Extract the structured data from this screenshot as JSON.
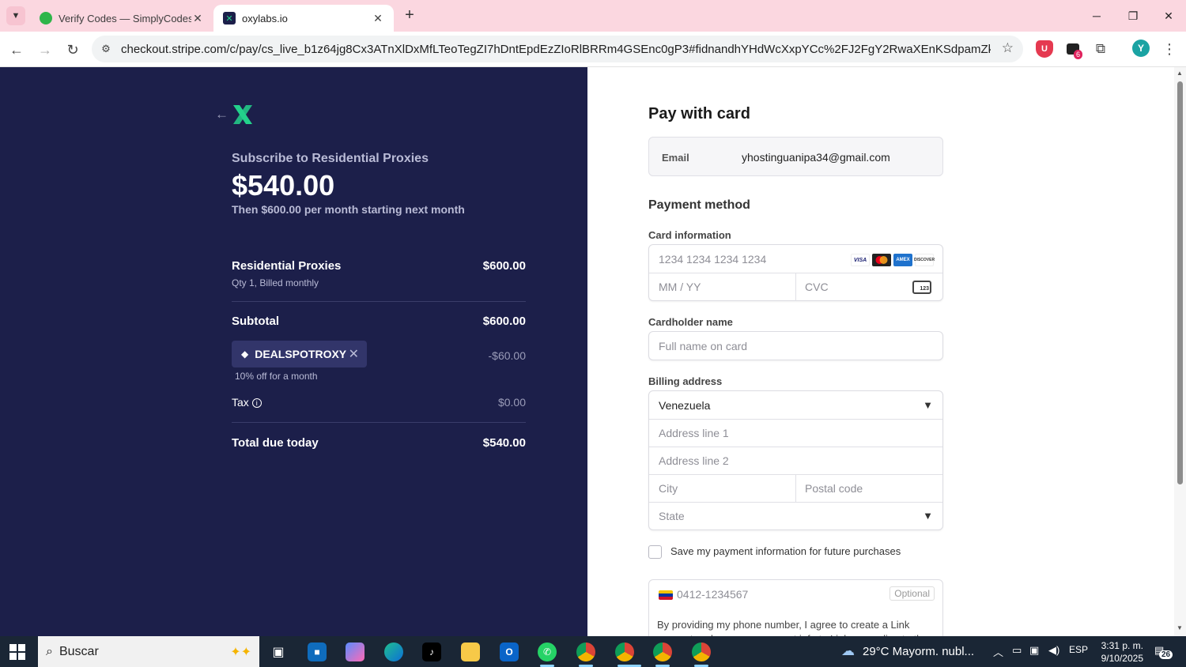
{
  "browser": {
    "tabs": [
      {
        "title": "Verify Codes — SimplyCodes",
        "active": false
      },
      {
        "title": "oxylabs.io",
        "active": true
      }
    ],
    "url": "checkout.stripe.com/c/pay/cs_live_b1z64jg8Cx3ATnXlDxMfLTeoTegZI7hDntEpdEzZIoRlBRRm4GSEnc0gP3#fidnandhYHdWcXxpYCc%2FJ2FgY2RwaXEnKSdpamZkaWAnPydgaycpJ3ZwZ...",
    "extension_badge": "6",
    "profile_initial": "Y"
  },
  "summary": {
    "product_label": "Subscribe to Residential Proxies",
    "price": "$540.00",
    "then_text": "Then $600.00 per month starting next month",
    "line_item": {
      "name": "Residential Proxies",
      "sub": "Qty 1, Billed monthly",
      "amount": "$600.00"
    },
    "subtotal": {
      "label": "Subtotal",
      "amount": "$600.00"
    },
    "promo": {
      "code": "DEALSPOTROXY",
      "amount": "-$60.00",
      "note": "10% off for a month"
    },
    "tax": {
      "label": "Tax",
      "amount": "$0.00"
    },
    "total": {
      "label": "Total due today",
      "amount": "$540.00"
    }
  },
  "form": {
    "title": "Pay with card",
    "email_label": "Email",
    "email_value": "yhostinguanipa34@gmail.com",
    "payment_method": "Payment method",
    "card_info_label": "Card information",
    "card_number_ph": "1234 1234 1234 1234",
    "expiry_ph": "MM / YY",
    "cvc_ph": "CVC",
    "cvc_icon_text": "123",
    "card_brands": [
      "VISA",
      "MC",
      "AMEX",
      "DISCOVER"
    ],
    "cardholder_label": "Cardholder name",
    "cardholder_ph": "Full name on card",
    "billing_label": "Billing address",
    "country": "Venezuela",
    "address1_ph": "Address line 1",
    "address2_ph": "Address line 2",
    "city_ph": "City",
    "postal_ph": "Postal code",
    "state_ph": "State",
    "save_label": "Save my payment information for future purchases",
    "phone_ph": "0412-1234567",
    "optional_label": "Optional",
    "phone_note": "By providing my phone number, I agree to create a Link account and save my payment info to Link, according to the"
  },
  "taskbar": {
    "search_text": "Buscar",
    "weather": "29°C  Mayorm. nubl...",
    "language": "ESP",
    "time": "3:31 p. m.",
    "date": "9/10/2025",
    "notif_count": "26"
  },
  "colors": {
    "summary_bg": "#1c1f4a",
    "brand_green": "#23d18b",
    "tab_strip": "#fbd7e0"
  }
}
